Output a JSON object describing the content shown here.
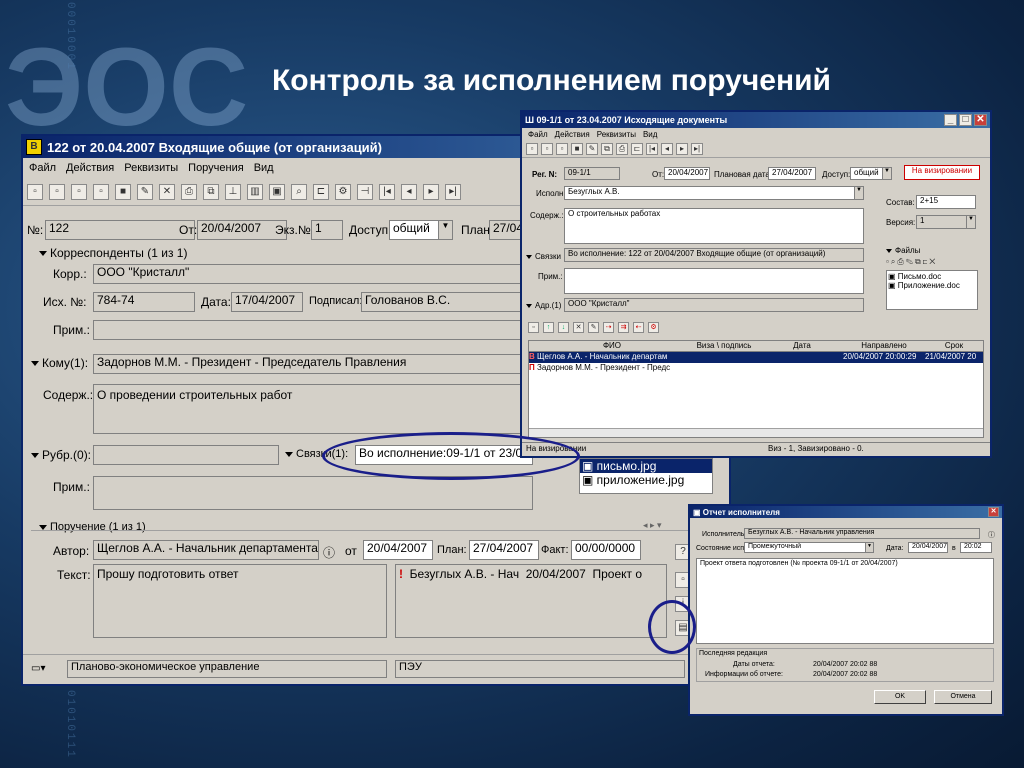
{
  "slide": {
    "title": "Контроль за исполнением поручений",
    "logo": "ЭОС",
    "binary_top": "00010001",
    "binary_left": "0101110",
    "binary_bottom": "01010111"
  },
  "main": {
    "title": "122 от 20.04.2007 Входящие общие (от организаций)",
    "menu": [
      "Файл",
      "Действия",
      "Реквизиты",
      "Поручения",
      "Вид"
    ],
    "fields": {
      "num_label": "№:",
      "num": "122",
      "from_label": "От:",
      "from": "20/04/2007",
      "copy_label": "Экз.№:",
      "copy": "1",
      "access_label": "Доступ:",
      "access": "общий",
      "plan_label": "План:",
      "plan": "27/04"
    },
    "corr": {
      "header": "Корреспонденты (1 из 1)",
      "org_label": "Корр.:",
      "org": "ООО \"Кристалл\"",
      "out_label": "Исх. №:",
      "out": "784-74",
      "date_label": "Дата:",
      "date": "17/04/2007",
      "signed_label": "Подписал:",
      "signed": "Голованов В.С.",
      "note_label": "Прим.:"
    },
    "to_label": "Кому(1):",
    "to": "Задорнов М.М. - Президент - Председатель Правления",
    "content_label": "Содерж.:",
    "content": "О проведении строительных работ",
    "rubr_label": "Рубр.(0):",
    "links_label": "Связки(1):",
    "links": "Во исполнение:09-1/1 от 23/0",
    "note2_label": "Прим.:",
    "files": [
      "письмо.jpg",
      "приложение.jpg"
    ],
    "order": {
      "header": "Поручение (1 из 1)",
      "author_label": "Автор:",
      "author": "Щеглов А.А. - Начальник департамента",
      "from_label": "от",
      "from": "20/04/2007",
      "plan_label": "План:",
      "plan": "27/04/2007",
      "fact_label": "Факт:",
      "fact": "00/00/0000",
      "text_label": "Текст:",
      "text": "Прошу подготовить ответ",
      "exec_mark": "!",
      "exec": "Безуглых А.В. - Нач",
      "exec_date": "20/04/2007",
      "exec_project": "Проект о"
    },
    "status": {
      "dept": "Планово-экономическое управление",
      "code": "ПЭУ"
    }
  },
  "out": {
    "title": "09-1/1 от 23.04.2007 Исходящие документы",
    "menu": [
      "Файл",
      "Действия",
      "Реквизиты",
      "Вид"
    ],
    "reg_label": "Рег. N:",
    "reg": "09-1/1",
    "from_label": "От:",
    "from": "20/04/2007",
    "plan_label": "Плановая дата:",
    "plan": "27/04/2007",
    "access_label": "Доступ:",
    "access": "общий",
    "state": "На визировании",
    "exec_label": "Исполн:",
    "exec": "Безуглых А.В.",
    "content_label": "Содерж.:",
    "content": "О строительных работах",
    "comp_label": "Состав:",
    "comp": "2+15",
    "ver_label": "Версия:",
    "ver": "1",
    "links_label": "Связки",
    "links": "Во исполнение: 122 от 20/04/2007 Входящие общие (от организаций)",
    "note_label": "Прим.:",
    "addr_label": "Адр.(1)",
    "addr": "ООО \"Кристалл\"",
    "files_label": "Файлы",
    "files": [
      "Письмо.doc",
      "Приложение.doc"
    ],
    "grid_headers": [
      "ФИО",
      "Виза \\ подпись",
      "Дата",
      "Направлено",
      "Срок"
    ],
    "grid_rows": [
      {
        "mark": "В",
        "fio": "Щеглов А.А. - Начальник департам",
        "visa": "",
        "date": "",
        "sent": "20/04/2007 20:00:29",
        "due": "21/04/2007 20"
      },
      {
        "mark": "П",
        "fio": "Задорнов М.М. - Президент - Предс",
        "visa": "",
        "date": "",
        "sent": "",
        "due": ""
      }
    ],
    "status_left": "На визировании",
    "status_right": "Виз - 1,  Завизировано - 0."
  },
  "report": {
    "title": "Отчет исполнителя",
    "exec_label": "Исполнитель:",
    "exec": "Безуглых А.В. - Начальник управления",
    "state_label": "Состояние исп.:",
    "state": "Промежуточный",
    "date_label": "Дата:",
    "date": "20/04/2007",
    "time_label": "в",
    "time": "20:02",
    "text": "Проект ответа подготовлен (№ проекта 09-1/1 от 20/04/2007)",
    "last_label": "Последняя редакция",
    "report_date_label": "Даты отчета:",
    "report_date": "20/04/2007 20:02  88",
    "info_date_label": "Информации об отчете:",
    "info_date": "20/04/2007 20:02  88",
    "ok": "OK",
    "cancel": "Отмена"
  }
}
